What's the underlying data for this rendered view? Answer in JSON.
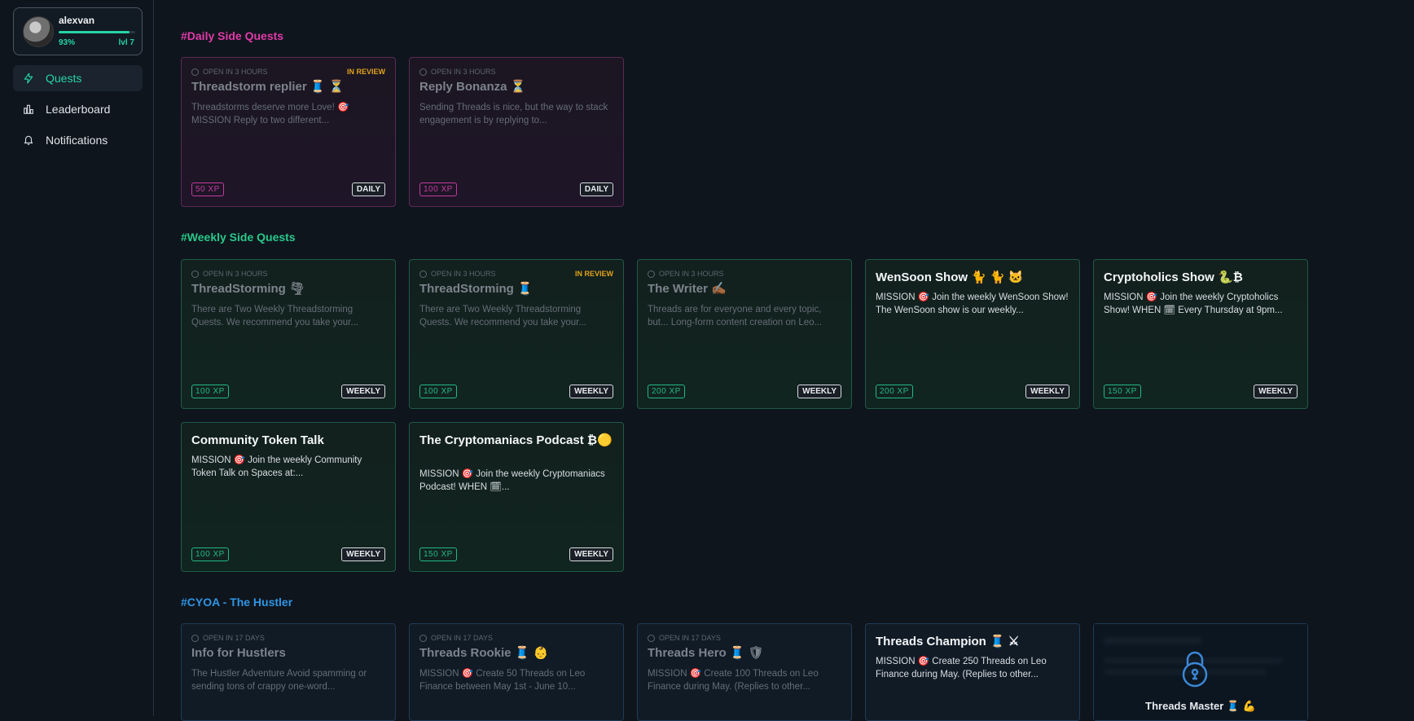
{
  "profile": {
    "username": "alexvan",
    "progress_pct": "93%",
    "progress_value": 0.93,
    "level": "lvl 7"
  },
  "nav": [
    {
      "label": "Quests",
      "icon": "bolt-icon",
      "active": true
    },
    {
      "label": "Leaderboard",
      "icon": "bar-chart-icon",
      "active": false
    },
    {
      "label": "Notifications",
      "icon": "bell-icon",
      "active": false
    }
  ],
  "sections": {
    "daily": {
      "title": "#Daily Side Quests",
      "color": "#e13aa8"
    },
    "weekly": {
      "title": "#Weekly Side Quests",
      "color": "#27c98a"
    },
    "cyoa": {
      "title": "#CYOA - The Hustler",
      "color": "#2d96e6"
    }
  },
  "daily_cards": [
    {
      "timer": "OPEN IN 3 HOURS",
      "status": "IN REVIEW",
      "title": "Threadstorm replier 🧵 ⏳",
      "desc": "Threadstorms deserve more Love! 🎯 MISSION Reply to two different...",
      "xp": "50 XP",
      "freq": "DAILY"
    },
    {
      "timer": "OPEN IN 3 HOURS",
      "status": "",
      "title": "Reply Bonanza ⏳",
      "desc": "Sending Threads is nice, but the way to stack engagement is by replying to...",
      "xp": "100 XP",
      "freq": "DAILY"
    }
  ],
  "weekly_cards": [
    {
      "timer": "OPEN IN 3 HOURS",
      "status": "",
      "title": "ThreadStorming 🌪",
      "desc": "There are Two Weekly Threadstorming Quests. We recommend you take your...",
      "xp": "100 XP",
      "freq": "WEEKLY"
    },
    {
      "timer": "OPEN IN 3 HOURS",
      "status": "IN REVIEW",
      "title": "ThreadStorming 🧵",
      "desc": "There are Two Weekly Threadstorming Quests. We recommend you take your...",
      "xp": "100 XP",
      "freq": "WEEKLY"
    },
    {
      "timer": "OPEN IN 3 HOURS",
      "status": "",
      "title": "The Writer ✍🏾",
      "desc": "Threads are for everyone and every topic, but... Long-form content creation on Leo...",
      "xp": "200 XP",
      "freq": "WEEKLY"
    },
    {
      "timer": "",
      "status": "",
      "title": "WenSoon Show 🐈 🐈 🐱",
      "desc": "MISSION 🎯 Join the weekly WenSoon Show!  The WenSoon show is our weekly...",
      "xp": "200 XP",
      "freq": "WEEKLY"
    },
    {
      "timer": "",
      "status": "",
      "title": "Cryptoholics Show 🐍₿",
      "desc": "MISSION 🎯 Join the weekly Cryptoholics Show!  WHEN 🗓 Every Thursday at 9pm...",
      "xp": "150 XP",
      "freq": "WEEKLY"
    },
    {
      "timer": "",
      "status": "",
      "title": "Community Token Talk",
      "desc": "MISSION 🎯 Join the weekly Community Token Talk on Spaces at:...",
      "xp": "100 XP",
      "freq": "WEEKLY"
    },
    {
      "timer": "",
      "status": "",
      "title": "The Cryptomaniacs Podcast ₿🟡",
      "desc": "MISSION 🎯 Join the weekly Cryptomaniacs Podcast!  WHEN 🗓...",
      "xp": "150 XP",
      "freq": "WEEKLY"
    }
  ],
  "cyoa_cards": [
    {
      "timer": "OPEN IN 17 DAYS",
      "title": "Info for Hustlers",
      "desc": "The Hustler Adventure Avoid spamming or sending tons of crappy one-word..."
    },
    {
      "timer": "OPEN IN 17 DAYS",
      "title": "Threads Rookie 🧵 👶",
      "desc": "MISSION 🎯 Create 50 Threads on Leo Finance between May 1st - June 10..."
    },
    {
      "timer": "OPEN IN 17 DAYS",
      "title": "Threads Hero 🧵 🛡",
      "desc": "MISSION 🎯 Create 100 Threads on Leo Finance during May. (Replies to other..."
    },
    {
      "timer": "",
      "title": "Threads Champion 🧵 ⚔",
      "desc": "MISSION 🎯 Create 250 Threads on Leo Finance during May. (Replies to other..."
    },
    {
      "timer": "",
      "title": "Threads Master 🧵 💪",
      "desc": "",
      "locked": true
    }
  ]
}
